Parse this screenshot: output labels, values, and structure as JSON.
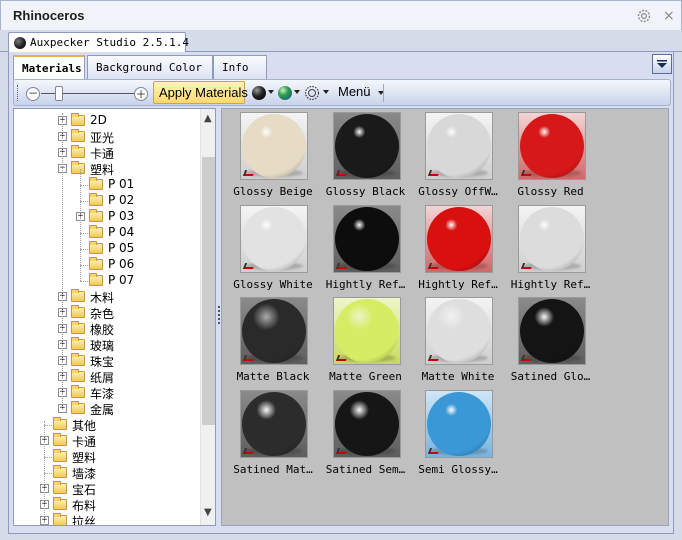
{
  "app": {
    "title": "Rhinoceros"
  },
  "document_tab": {
    "label": "Auxpecker Studio 2.5.1.4"
  },
  "tabs": [
    {
      "label": "Materials",
      "active": true
    },
    {
      "label": "Background Color",
      "active": false
    },
    {
      "label": "Info",
      "active": false
    }
  ],
  "toolbar": {
    "zoom_out_symbol": "−",
    "zoom_in_symbol": "+",
    "zoom_level": 0.2,
    "apply_label": "Apply Materials",
    "menu_label": "Menü",
    "icons": [
      "sphere-black-icon",
      "sphere-green-blue-icon",
      "gear-sun-icon"
    ]
  },
  "tree": {
    "items": [
      {
        "label": "2D",
        "depth": 2,
        "expandable": true
      },
      {
        "label": "亚光",
        "depth": 2,
        "expandable": true
      },
      {
        "label": "卡通",
        "depth": 2,
        "expandable": true
      },
      {
        "label": "塑料",
        "depth": 2,
        "expandable": true,
        "expanded": true
      },
      {
        "label": "P 01",
        "depth": 3,
        "expandable": false
      },
      {
        "label": "P 02",
        "depth": 3,
        "expandable": false
      },
      {
        "label": "P 03",
        "depth": 3,
        "expandable": true
      },
      {
        "label": "P 04",
        "depth": 3,
        "expandable": false
      },
      {
        "label": "P 05",
        "depth": 3,
        "expandable": false
      },
      {
        "label": "P 06",
        "depth": 3,
        "expandable": false
      },
      {
        "label": "P 07",
        "depth": 3,
        "expandable": false
      },
      {
        "label": "木料",
        "depth": 2,
        "expandable": true
      },
      {
        "label": "杂色",
        "depth": 2,
        "expandable": true
      },
      {
        "label": "橡胶",
        "depth": 2,
        "expandable": true
      },
      {
        "label": "玻璃",
        "depth": 2,
        "expandable": true
      },
      {
        "label": "珠宝",
        "depth": 2,
        "expandable": true
      },
      {
        "label": "纸屑",
        "depth": 2,
        "expandable": true
      },
      {
        "label": "车漆",
        "depth": 2,
        "expandable": true
      },
      {
        "label": "金属",
        "depth": 2,
        "expandable": true
      },
      {
        "label": "其他",
        "depth": 1,
        "expandable": false
      },
      {
        "label": "卡通",
        "depth": 1,
        "expandable": true
      },
      {
        "label": "塑料",
        "depth": 1,
        "expandable": false
      },
      {
        "label": "墙漆",
        "depth": 1,
        "expandable": false
      },
      {
        "label": "宝石",
        "depth": 1,
        "expandable": true
      },
      {
        "label": "布料",
        "depth": 1,
        "expandable": true
      },
      {
        "label": "拉丝",
        "depth": 1,
        "expandable": true
      }
    ]
  },
  "materials": [
    {
      "name": "Glossy Beige",
      "color": "#e6dcc6",
      "style": "glossy"
    },
    {
      "name": "Glossy Black",
      "color": "#1a1a1a",
      "style": "glossy"
    },
    {
      "name": "Glossy OffW…",
      "color": "#d8d8d8",
      "style": "glossy"
    },
    {
      "name": "Glossy Red",
      "color": "#d61818",
      "style": "glossy"
    },
    {
      "name": "Glossy White",
      "color": "#e2e2e2",
      "style": "glossy"
    },
    {
      "name": "Hightly Ref…",
      "color": "#0d0d0d",
      "style": "glossy"
    },
    {
      "name": "Hightly Ref…",
      "color": "#d81010",
      "style": "glossy"
    },
    {
      "name": "Hightly Ref…",
      "color": "#dcdcdc",
      "style": "glossy"
    },
    {
      "name": "Matte Black",
      "color": "#2a2a2a",
      "style": "matte"
    },
    {
      "name": "Matte Green",
      "color": "#d6ec64",
      "style": "matte"
    },
    {
      "name": "Matte White",
      "color": "#dedede",
      "style": "matte"
    },
    {
      "name": "Satined Glo…",
      "color": "#141414",
      "style": "satin"
    },
    {
      "name": "Satined Mat…",
      "color": "#2c2c2c",
      "style": "satin"
    },
    {
      "name": "Satined Sem…",
      "color": "#161616",
      "style": "satin"
    },
    {
      "name": "Semi Glossy…",
      "color": "#3a98d6",
      "style": "glossy"
    }
  ]
}
